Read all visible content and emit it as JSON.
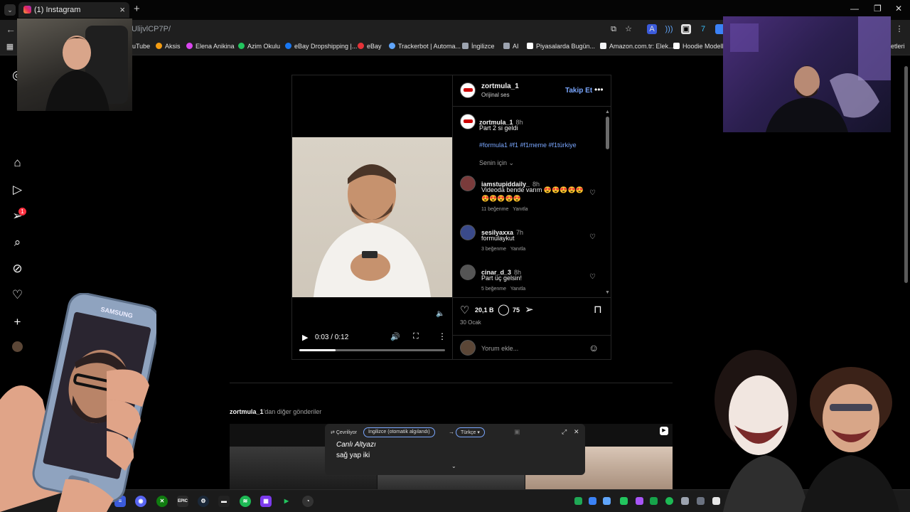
{
  "browser": {
    "tab_title": "(1) Instagram",
    "url": "UlijvlCP7P/",
    "window_controls": {
      "minimize": "—",
      "maximize": "❐",
      "close": "✕"
    },
    "bookmarks": [
      {
        "label": "uTube",
        "color": "#ff0000"
      },
      {
        "label": "Aksis",
        "color": "#f39c12"
      },
      {
        "label": "Elena Anikina",
        "color": "#d946ef"
      },
      {
        "label": "Azim Okulu",
        "color": "#22c55e"
      },
      {
        "label": "eBay Dropshipping |...",
        "color": "#1877f2"
      },
      {
        "label": "eBay",
        "color": "#e53238"
      },
      {
        "label": "Trackerbot | Automa...",
        "color": "#60a5fa"
      },
      {
        "label": "İngilizce",
        "color": "#9ca3af"
      },
      {
        "label": "AI",
        "color": "#9ca3af"
      },
      {
        "label": "Piyasalarda Bugün...",
        "color": "#ffffff"
      },
      {
        "label": "Amazon.com.tr: Elek...",
        "color": "#f3f4f6"
      },
      {
        "label": "Hoodie Modelle",
        "color": "#ffffff"
      },
      {
        "label": "etleri",
        "color": "#9ca3af"
      }
    ]
  },
  "nav": {
    "notifications_badge": "1",
    "icons": [
      "home-icon",
      "reels-icon",
      "messages-icon",
      "search-icon",
      "explore-icon",
      "notifications-icon",
      "create-icon",
      "profile-icon"
    ]
  },
  "post": {
    "author": "zortmula_1",
    "audio": "Orijinal ses",
    "follow_label": "Takip Et",
    "caption_user": "zortmula_1",
    "caption_time": "8h",
    "caption_text": "Part 2 si geldi",
    "hashtags": "#formula1 #f1 #f1meme #f1türkiye",
    "sort_label": "Senin için",
    "comments": [
      {
        "user": "iamstupiddaily_",
        "time": "8h",
        "text": "Videoda bende varım 😍😍😍😍😍😍😍😍😍😍",
        "likes": "11 beğenme",
        "reply": "Yanıtla"
      },
      {
        "user": "sesilyaxxa",
        "time": "7h",
        "text": "formulaykut",
        "likes": "3 beğenme",
        "reply": "Yanıtla"
      },
      {
        "user": "cinar_d_3",
        "time": "8h",
        "text": "Part üç gelsin!",
        "likes": "5 beğenme",
        "reply": "Yanıtla"
      }
    ],
    "like_count": "20,1 B",
    "comment_count": "75",
    "date": "30 Ocak",
    "add_comment_placeholder": "Yorum ekle...",
    "video": {
      "time": "0:03 / 0:12",
      "progress": 0.25
    }
  },
  "more_posts": {
    "user": "zortmula_1",
    "suffix": "'dan diğer gönderiler"
  },
  "live_caption": {
    "translating": "Çevriliyor",
    "source_lang": "İngilizce (otomatik algılandı)",
    "target_lang": "Türkçe",
    "title": "Canlı Altyazı",
    "text": "sağ yap iki"
  },
  "overlays": {
    "phone_brand": "SAMSUNG"
  },
  "taskbar": {
    "apps": [
      "chrome",
      "app-blue",
      "discord",
      "xbox",
      "epic",
      "steam",
      "app-dark",
      "spotify",
      "app-purple",
      "app-green",
      "app-red"
    ]
  },
  "colors": {
    "accent": "#7aa7ff",
    "notification": "#ff3040",
    "background": "#000000"
  }
}
